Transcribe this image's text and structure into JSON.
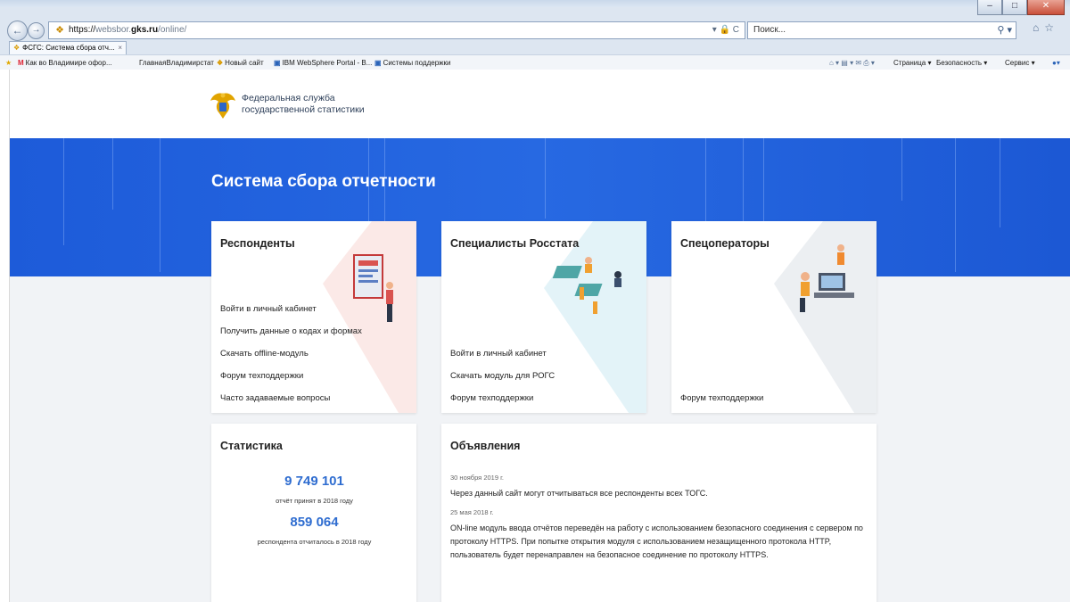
{
  "browser": {
    "address": {
      "url_host_prefix": "https://",
      "url_host_dim": "websbor.",
      "url_host": "gks.ru",
      "url_path": "/online/",
      "controls": "▾ 🔒 C"
    },
    "search": {
      "placeholder": "Поиск...",
      "button": "⚲ ▾"
    },
    "tab": {
      "label": "ФСГС: Система сбора отч...",
      "close": "×"
    },
    "favorites": [
      "Как во Владимире офор...",
      "ГлавнаяВладимирстат",
      "Новый сайт",
      "IBM WebSphere Portal - B...",
      "Системы поддержки"
    ],
    "commands": [
      "Страница ▾",
      "Безопасность ▾",
      "Сервис ▾"
    ]
  },
  "header": {
    "org_line1": "Федеральная служба",
    "org_line2": "государственной статистики"
  },
  "hero": {
    "title": "Система сбора отчетности"
  },
  "cards": {
    "respondents": {
      "title": "Респонденты",
      "links": [
        "Войти в личный кабинет",
        "Получить данные о кодах и формах",
        "Скачать offline-модуль",
        "Форум техподдержки",
        "Часто задаваемые вопросы"
      ]
    },
    "specialists": {
      "title": "Специалисты Росстата",
      "links": [
        "Войти в личный кабинет",
        "Скачать модуль для РОГС",
        "Форум техподдержки"
      ]
    },
    "operators": {
      "title": "Спецоператоры",
      "links": [
        "Форум техподдержки"
      ]
    }
  },
  "statistics": {
    "title": "Статистика",
    "reports_value": "9 749 101",
    "reports_caption": "отчёт принят в 2018 году",
    "respondents_value": "859 064",
    "respondents_caption": "респондента отчиталось в 2018 году"
  },
  "announcements": {
    "title": "Объявления",
    "items": [
      {
        "date": "30 ноября 2019 г.",
        "text": "Через данный сайт могут отчитываться все респонденты всех ТОГС."
      },
      {
        "date": "25 мая 2018 г.",
        "text": "ON-line модуль ввода отчётов переведён на работу с использованием безопасного соединения с сервером по протоколу HTTPS. При попытке открытия модуля с использованием незащищенного протокола HTTP, пользователь будет перенаправлен на безопасное соединение по протоколу HTTPS."
      }
    ]
  },
  "colors": {
    "hero_blue": "#2366e0",
    "accent_number": "#2f6dd0",
    "page_bg": "#f1f3f6"
  }
}
